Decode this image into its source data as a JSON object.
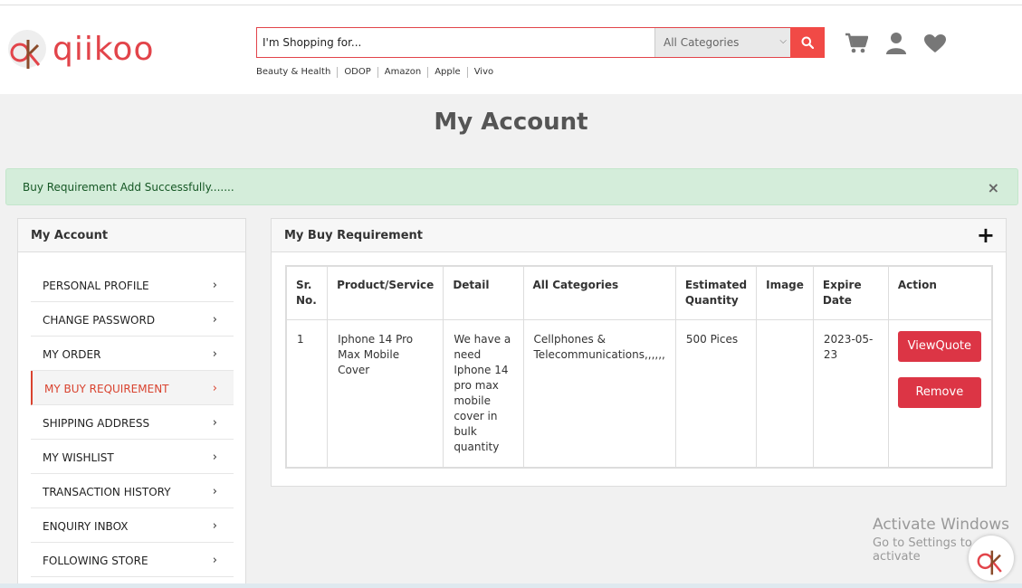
{
  "brand": {
    "logo_text": "qiikoo",
    "accent_color": "#e2444a"
  },
  "search": {
    "placeholder": "I'm Shopping for...",
    "category_selected": "All Categories",
    "button_icon": "search-icon"
  },
  "quick_links": [
    "Beauty & Health",
    "ODOP",
    "Amazon",
    "Apple",
    "Vivo"
  ],
  "header_icons": [
    "cart-icon",
    "user-icon",
    "heart-icon"
  ],
  "page_title": "My Account",
  "alert": {
    "message": "Buy Requirement Add Successfully.......",
    "close": "×"
  },
  "sidebar": {
    "title": "My Account",
    "items": [
      {
        "label": "PERSONAL PROFILE",
        "active": false
      },
      {
        "label": "CHANGE PASSWORD",
        "active": false
      },
      {
        "label": "MY ORDER",
        "active": false
      },
      {
        "label": "MY BUY REQUIREMENT",
        "active": true
      },
      {
        "label": "SHIPPING ADDRESS",
        "active": false
      },
      {
        "label": "MY WISHLIST",
        "active": false
      },
      {
        "label": "TRANSACTION HISTORY",
        "active": false
      },
      {
        "label": "ENQUIRY INBOX",
        "active": false
      },
      {
        "label": "FOLLOWING STORE",
        "active": false
      }
    ],
    "chevron": "›"
  },
  "main": {
    "title": "My Buy Requirement",
    "add_label": "+",
    "table": {
      "headers": [
        "Sr. No.",
        "Product/Service",
        "Detail",
        "All Categories",
        "Estimated Quantity",
        "Image",
        "Expire Date",
        "Action"
      ],
      "rows": [
        {
          "sr": "1",
          "product": "Iphone 14 Pro Max Mobile Cover",
          "detail": "We have a need Iphone 14 pro max mobile cover in bulk quantity",
          "categories": "Cellphones & Telecommunications,,,,,,",
          "quantity": "500 Pices",
          "image": "",
          "expire": "2023-05-23",
          "view_label": "ViewQuote",
          "remove_label": "Remove"
        }
      ]
    }
  },
  "watermark": {
    "line1": "Activate Windows",
    "line2": "Go to Settings to activate"
  }
}
